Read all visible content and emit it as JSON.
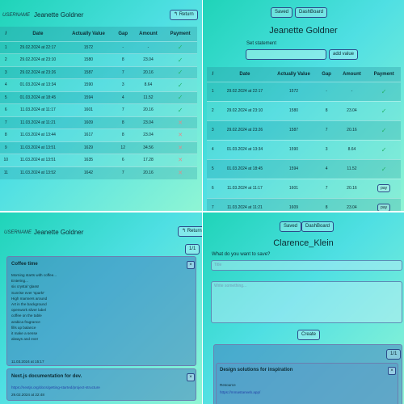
{
  "top_left": {
    "username_label": "USERNAME",
    "username": "Jeanette Goldner",
    "return_label": "Return",
    "columns": [
      "/",
      "Date",
      "Actually Value",
      "Gap",
      "Amount",
      "Payment"
    ],
    "rows": [
      {
        "n": "1",
        "date": "29.02.2024 at 22:17",
        "value": "1572",
        "gap": "-",
        "amount": "-",
        "status": "check"
      },
      {
        "n": "2",
        "date": "29.02.2024 at 23:10",
        "value": "1580",
        "gap": "8",
        "amount": "23.04",
        "status": "check"
      },
      {
        "n": "3",
        "date": "29.02.2024 at 23:26",
        "value": "1587",
        "gap": "7",
        "amount": "20.16",
        "status": "check"
      },
      {
        "n": "4",
        "date": "01.03.2024 at 13:34",
        "value": "1590",
        "gap": "3",
        "amount": "8.64",
        "status": "check"
      },
      {
        "n": "5",
        "date": "01.03.2024 at 18:45",
        "value": "1594",
        "gap": "4",
        "amount": "11.52",
        "status": "check"
      },
      {
        "n": "6",
        "date": "11.03.2024 at 11:17",
        "value": "1601",
        "gap": "7",
        "amount": "20.16",
        "status": "check"
      },
      {
        "n": "7",
        "date": "11.03.2024 at 11:21",
        "value": "1609",
        "gap": "8",
        "amount": "23.04",
        "status": "cross"
      },
      {
        "n": "8",
        "date": "11.03.2024 at 13:44",
        "value": "1617",
        "gap": "8",
        "amount": "23.04",
        "status": "cross"
      },
      {
        "n": "9",
        "date": "11.03.2024 at 13:51",
        "value": "1629",
        "gap": "12",
        "amount": "34.56",
        "status": "cross"
      },
      {
        "n": "10",
        "date": "11.03.2024 at 13:51",
        "value": "1635",
        "gap": "6",
        "amount": "17.28",
        "status": "cross"
      },
      {
        "n": "11",
        "date": "11.03.2024 at 13:52",
        "value": "1642",
        "gap": "7",
        "amount": "20.16",
        "status": "cross"
      }
    ]
  },
  "top_right": {
    "saved_label": "Saved",
    "dashboard_label": "DashBoard",
    "title": "Jeanette Goldner",
    "set_statement_label": "Set statement",
    "add_value_label": "add value",
    "columns": [
      "/",
      "Date",
      "Actually Value",
      "Gap",
      "Amount",
      "Payment"
    ],
    "pay_label": "pay",
    "rows": [
      {
        "n": "1",
        "date": "29.02.2024 at 22:17",
        "value": "1572",
        "gap": "-",
        "amount": "-",
        "status": "check"
      },
      {
        "n": "2",
        "date": "29.02.2024 at 23:10",
        "value": "1580",
        "gap": "8",
        "amount": "23.04",
        "status": "check"
      },
      {
        "n": "3",
        "date": "29.02.2024 at 23:26",
        "value": "1587",
        "gap": "7",
        "amount": "20.16",
        "status": "check"
      },
      {
        "n": "4",
        "date": "01.03.2024 at 13:34",
        "value": "1590",
        "gap": "3",
        "amount": "8.64",
        "status": "check"
      },
      {
        "n": "5",
        "date": "01.03.2024 at 18:45",
        "value": "1594",
        "gap": "4",
        "amount": "11.52",
        "status": "check"
      },
      {
        "n": "6",
        "date": "11.03.2024 at 11:17",
        "value": "1601",
        "gap": "7",
        "amount": "20.16",
        "status": "pay"
      },
      {
        "n": "7",
        "date": "11.03.2024 at 11:21",
        "value": "1609",
        "gap": "8",
        "amount": "23.04",
        "status": "pay"
      }
    ]
  },
  "bottom_left": {
    "username_label": "USERNAME",
    "username": "Jeanette Goldner",
    "return_label": "Return",
    "page_indicator": "1/1",
    "card1": {
      "title": "Coffee time",
      "close": "×",
      "lines": [
        "Morning starts with coffee...",
        "Entering...",
        "six crystal 'glass!",
        "Sunrise ever 'spark!'",
        "High manners around",
        "Art in the background",
        "openwork silver label",
        "coffee on the table",
        "arabica fragrance",
        "fills up balance",
        "it make a sense",
        "always and ever"
      ],
      "date": "11.03.2024 at 15:17"
    },
    "card2": {
      "title": "Next.js documentation for dev.",
      "close": "×",
      "link": "https://nextjs.org/docs/getting-started/project-structure",
      "date": "29.02.2024 at 22:48"
    }
  },
  "bottom_right": {
    "saved_label": "Saved",
    "dashboard_label": "DashBoard",
    "title": "Clarence_Klein",
    "question": "What do you want to save?",
    "title_placeholder": "Title",
    "body_placeholder": "Write something...",
    "create_label": "Create",
    "page_indicator": "1/1",
    "card": {
      "title": "Design solutions for inspiration",
      "close": "×",
      "resource_label": "Resource",
      "link": "https://mmastarweb.app/"
    }
  }
}
